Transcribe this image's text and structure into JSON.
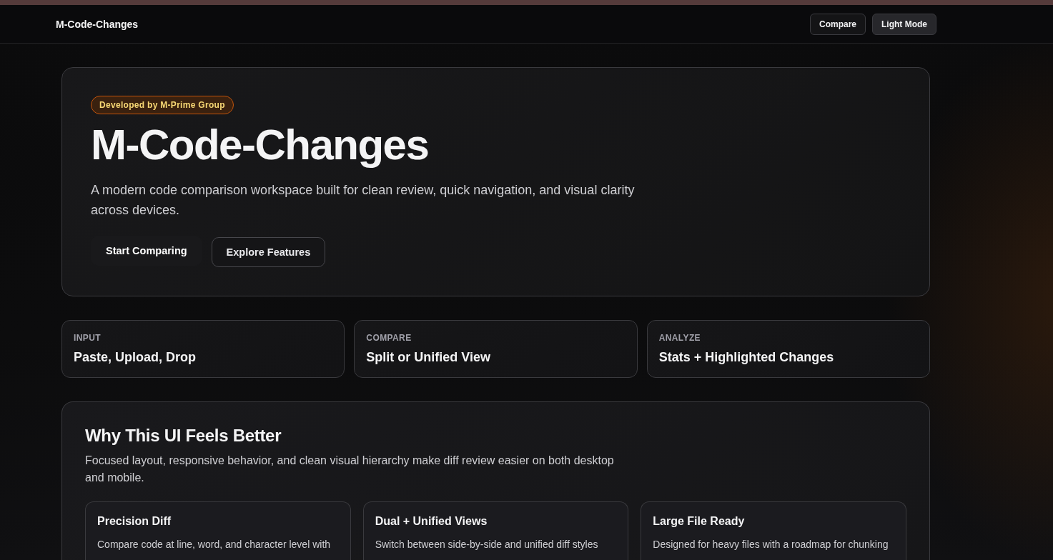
{
  "nav": {
    "brand": "M-Code-Changes",
    "buttons": [
      {
        "label": "Compare",
        "kind": "outline"
      },
      {
        "label": "Light Mode",
        "kind": "filled"
      }
    ]
  },
  "hero": {
    "badge": "Developed by M-Prime Group",
    "title": "M-Code-Changes",
    "lead": "A modern code comparison workspace built for clean review, quick navigation, and visual clarity across devices.",
    "actions": [
      {
        "label": "Start Comparing",
        "kind": "primary"
      },
      {
        "label": "Explore Features",
        "kind": "outline"
      }
    ]
  },
  "steps": [
    {
      "label": "INPUT",
      "title": "Paste, Upload, Drop"
    },
    {
      "label": "COMPARE",
      "title": "Split or Unified View"
    },
    {
      "label": "ANALYZE",
      "title": "Stats + Highlighted Changes"
    }
  ],
  "why": {
    "title": "Why This UI Feels Better",
    "text": "Focused layout, responsive behavior, and clean visual hierarchy make diff review easier on both desktop and mobile.",
    "features": [
      {
        "title": "Precision Diff",
        "text": "Compare code at line, word, and character level with"
      },
      {
        "title": "Dual + Unified Views",
        "text": "Switch between side-by-side and unified diff styles"
      },
      {
        "title": "Large File Ready",
        "text": "Designed for heavy files with a roadmap for chunking"
      }
    ]
  }
}
